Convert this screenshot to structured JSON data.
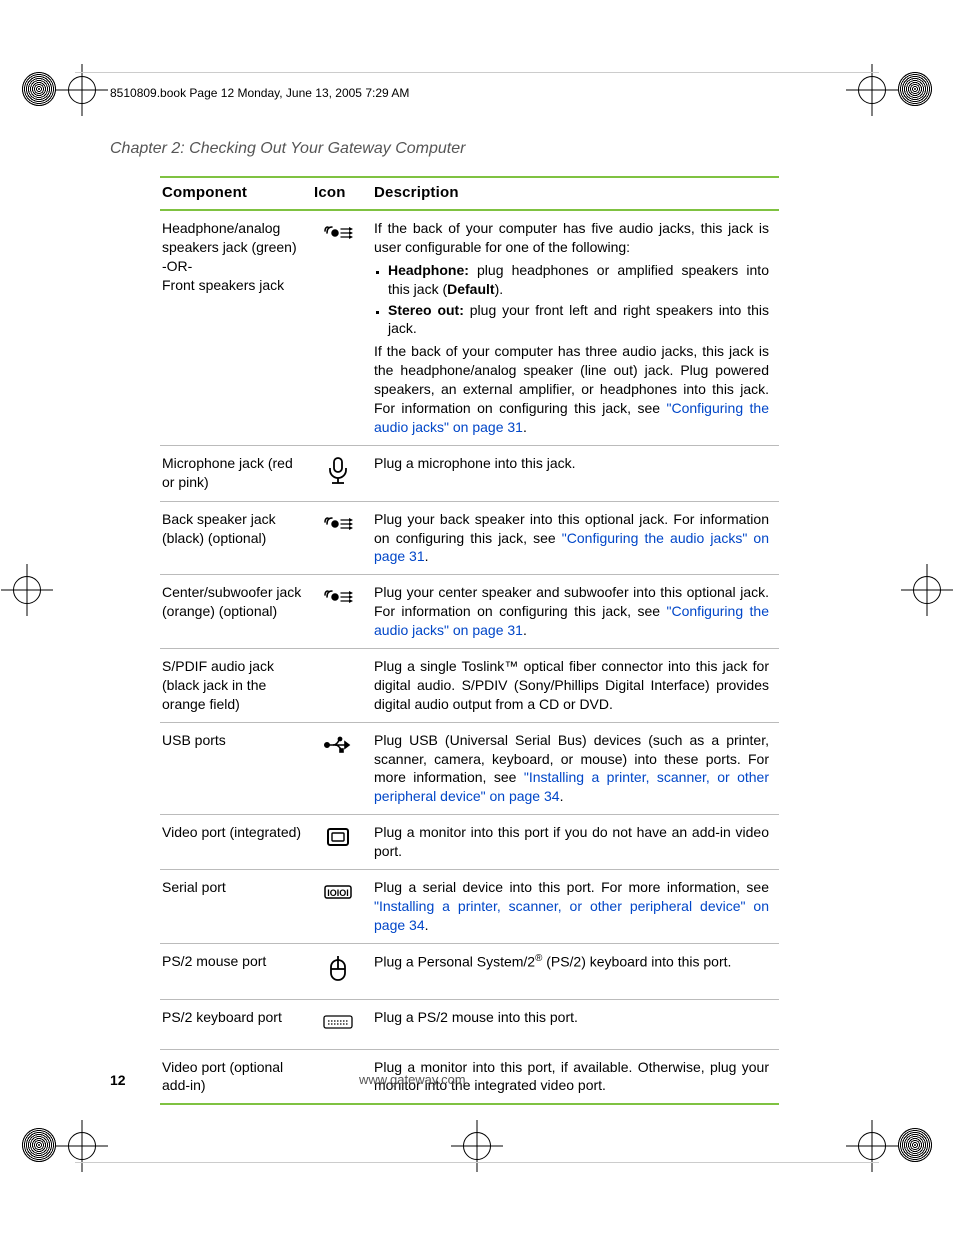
{
  "header_line": "8510809.book  Page 12  Monday, June 13, 2005  7:29 AM",
  "chapter_title": "Chapter 2: Checking Out Your Gateway Computer",
  "table": {
    "headers": {
      "component": "Component",
      "icon": "Icon",
      "description": "Description"
    },
    "rows": [
      {
        "component": "Headphone/analog speakers jack (green)\n-OR-\nFront speakers jack",
        "icon": "audio-out",
        "desc_intro": "If the back of your computer has five audio jacks, this jack is user configurable for one of the following:",
        "bullets": [
          {
            "label": "Headphone:",
            "text": " plug headphones or amplified speakers into this jack (",
            "bold_tail": "Default",
            "after": ")."
          },
          {
            "label": "Stereo out:",
            "text": " plug your front left and right speakers into this jack."
          }
        ],
        "desc_post_1": "If the back of your computer has three audio jacks, this jack is the headphone/analog speaker (line out) jack. Plug powered speakers, an external amplifier, or headphones into this jack. For information on configuring this jack, see ",
        "link_1": "\"Configuring the audio jacks\" on page 31",
        "desc_post_2": "."
      },
      {
        "component": "Microphone jack (red or pink)",
        "icon": "microphone",
        "desc": "Plug a microphone into this jack."
      },
      {
        "component": "Back speaker jack (black) (optional)",
        "icon": "audio-out",
        "desc_pre": "Plug your back speaker into this optional jack. For information on configuring this jack, see ",
        "link": "\"Configuring the audio jacks\" on page 31",
        "desc_post": "."
      },
      {
        "component": "Center/subwoofer jack\n(orange) (optional)",
        "icon": "audio-out",
        "desc_pre": "Plug your center speaker and subwoofer into this optional jack. For information on configuring this jack, see ",
        "link": "\"Configuring the audio jacks\" on page 31",
        "desc_post": "."
      },
      {
        "component": "S/PDIF audio jack (black jack in the orange field)",
        "icon": "",
        "desc": "Plug a single Toslink™ optical fiber connector into this jack for digital audio. S/PDIV (Sony/Phillips Digital Interface) provides digital audio output from a CD or DVD."
      },
      {
        "component": "USB ports",
        "icon": "usb",
        "desc_pre": "Plug USB (Universal Serial Bus) devices (such as a printer, scanner, camera, keyboard, or mouse) into these ports. For more information, see ",
        "link": "\"Installing a printer, scanner, or other peripheral device\" on page 34",
        "desc_post": "."
      },
      {
        "component": "Video port (integrated)",
        "icon": "monitor",
        "desc": "Plug a monitor into this port if you do not have an add-in video port."
      },
      {
        "component": "Serial port",
        "icon": "serial",
        "desc_pre": "Plug a serial device into this port. For more information, see ",
        "link": "\"Installing a printer, scanner, or other peripheral device\" on page 34",
        "desc_post": "."
      },
      {
        "component": "PS/2 mouse port",
        "icon": "mouse",
        "desc_pre": "Plug a Personal System/2",
        "sup": "®",
        "desc_post": " (PS/2) keyboard into this port."
      },
      {
        "component": "PS/2 keyboard port",
        "icon": "keyboard",
        "desc": "Plug a PS/2 mouse into this port."
      },
      {
        "component": "Video port (optional add-in)",
        "icon": "",
        "desc": "Plug a monitor into this port, if available. Otherwise, plug your monitor into the integrated video port."
      }
    ]
  },
  "footer": {
    "page": "12",
    "url": "www.gateway.com"
  }
}
